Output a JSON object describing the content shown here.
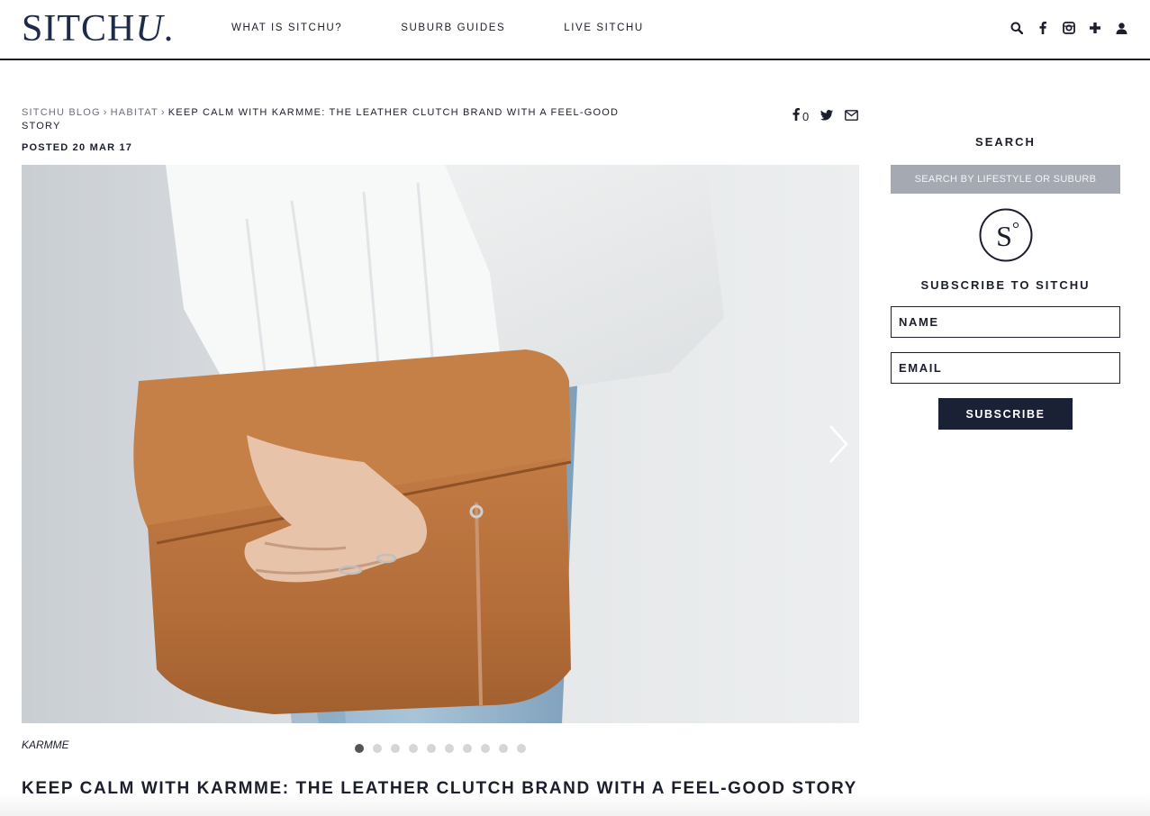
{
  "header": {
    "logo_main": "SITCH",
    "logo_u": "U",
    "logo_dot": ".",
    "nav": [
      "WHAT IS SITCHU?",
      "SUBURB GUIDES",
      "LIVE SITCHU"
    ],
    "icons": [
      "search-icon",
      "facebook-icon",
      "instagram-icon",
      "plus-icon",
      "user-icon"
    ]
  },
  "breadcrumb": {
    "items": [
      "SITCHU BLOG",
      "HABITAT"
    ],
    "separator": "›",
    "current": "KEEP CALM WITH KARMME: THE LEATHER CLUTCH BRAND WITH A FEEL-GOOD STORY"
  },
  "posted": "POSTED 20 MAR 17",
  "share": {
    "facebook_count": "0",
    "icons": [
      "facebook-icon",
      "twitter-icon",
      "email-icon"
    ]
  },
  "gallery": {
    "caption": "KARMME",
    "slide_count": 10,
    "active_index": 0,
    "next_icon": "chevron-right-icon"
  },
  "article": {
    "title": "KEEP CALM WITH KARMME: THE LEATHER CLUTCH BRAND WITH A FEEL-GOOD STORY"
  },
  "sidebar": {
    "search_heading": "SEARCH",
    "search_placeholder": "SEARCH BY LIFESTYLE OR SUBURB",
    "logo_letter": "S",
    "subscribe_heading": "SUBSCRIBE TO SITCHU",
    "name_placeholder": "NAME",
    "email_placeholder": "EMAIL",
    "subscribe_label": "SUBSCRIBE"
  },
  "colors": {
    "navy": "#1b2135",
    "search_bg": "#a4a9b2",
    "leather": "#b87240"
  }
}
